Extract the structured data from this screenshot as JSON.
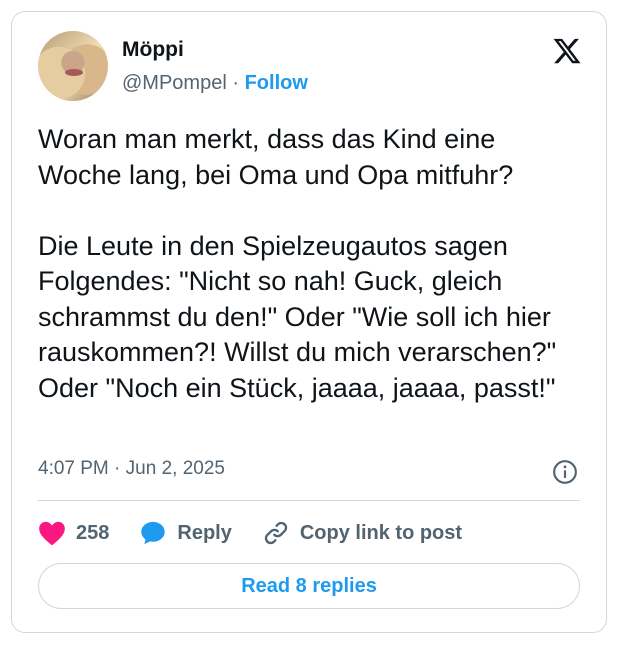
{
  "author": {
    "name": "Möppi",
    "handle": "@MPompel",
    "separator": "·",
    "follow_label": "Follow"
  },
  "tweet": {
    "text": "Woran man merkt, dass das Kind eine Woche lang, bei Oma und Opa mitfuhr?\n\nDie Leute in den Spielzeugautos sagen Folgendes: \"Nicht so nah! Guck, gleich schrammst du den!\" Oder \"Wie soll ich hier rauskommen?! Willst du mich verarschen?\" Oder \"Noch ein Stück, jaaaa, jaaaa, passt!\"",
    "time": "4:07 PM",
    "separator": "·",
    "date": "Jun 2, 2025"
  },
  "actions": {
    "like_count": "258",
    "reply_label": "Reply",
    "copy_link_label": "Copy link to post"
  },
  "read_replies_label": "Read 8 replies",
  "icons": {
    "brand": "x-logo-icon",
    "info": "info-icon",
    "like": "heart-icon",
    "reply": "speech-bubble-icon",
    "copy": "link-icon"
  },
  "colors": {
    "accent": "#1d9bf0",
    "like": "#f91880",
    "text": "#0f1419",
    "secondary": "#536471"
  }
}
